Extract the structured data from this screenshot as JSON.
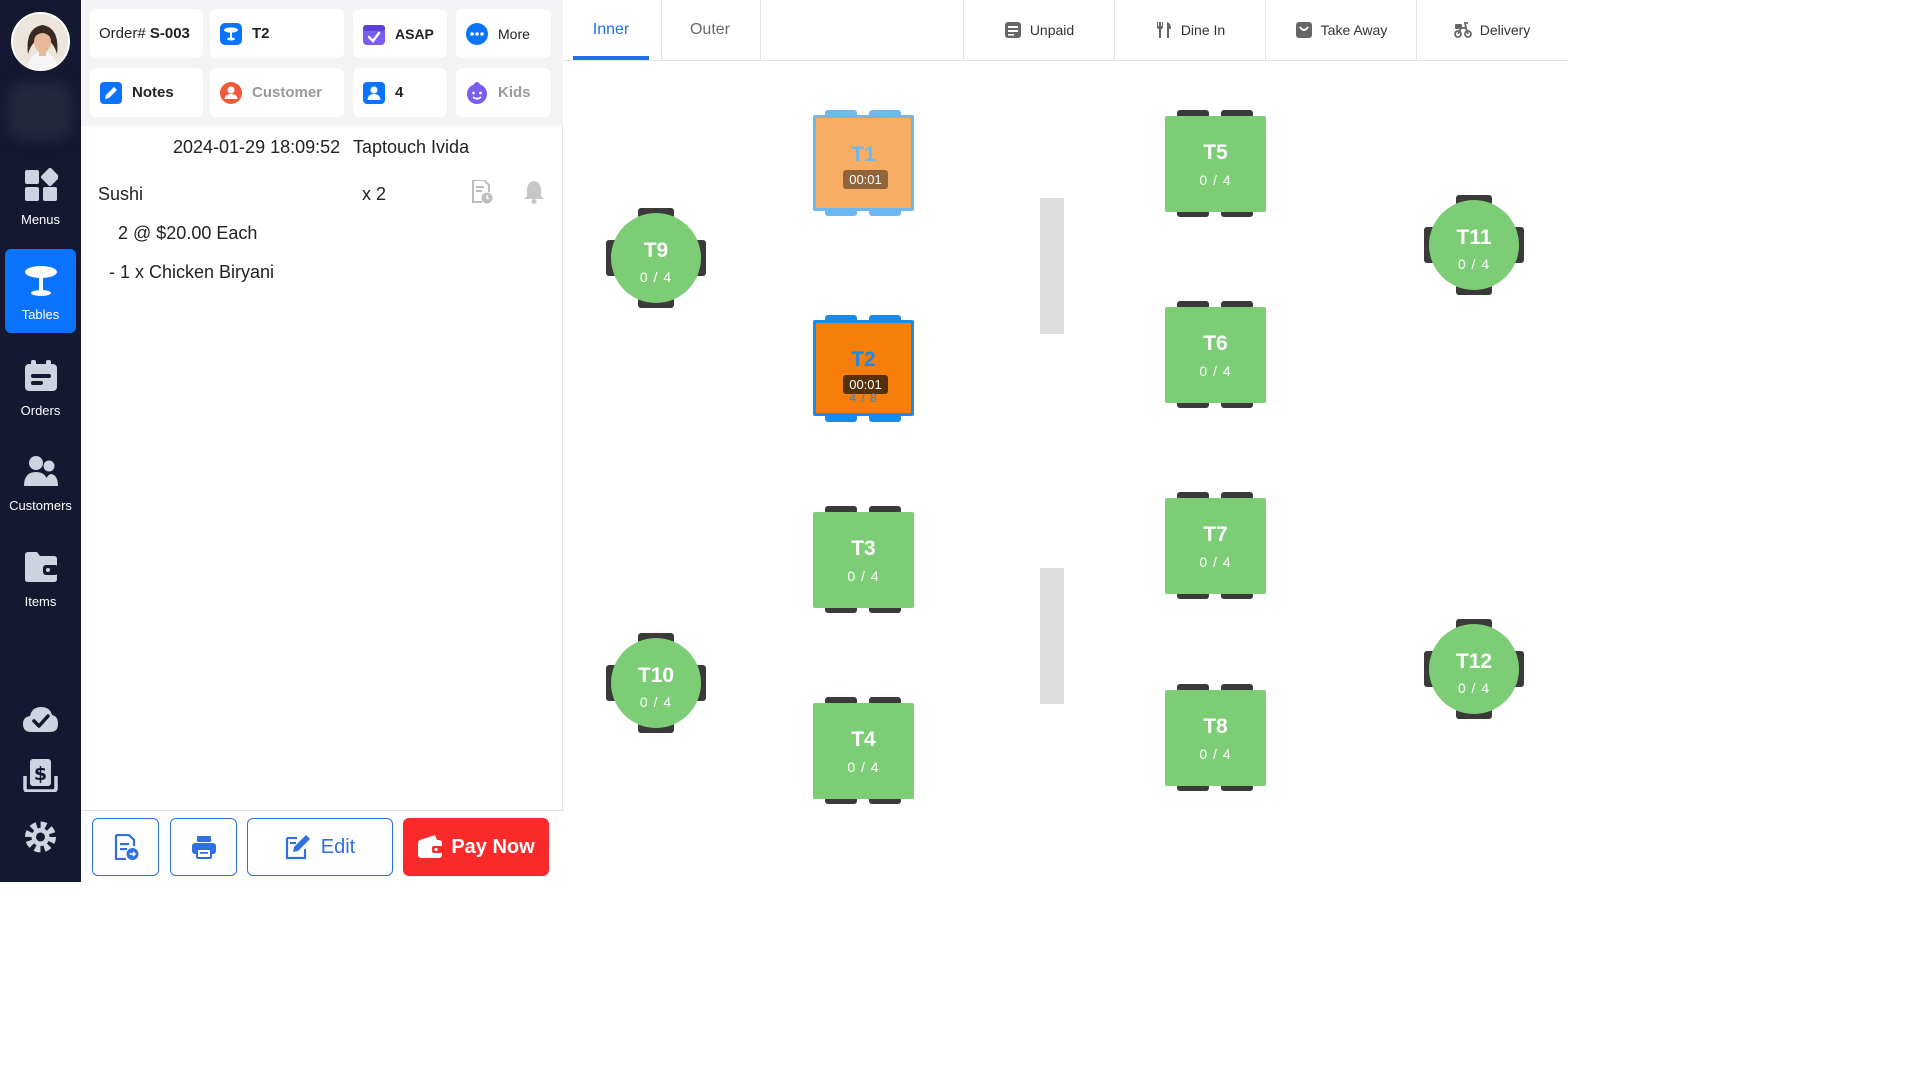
{
  "nav": {
    "items": [
      {
        "label": "Menus",
        "icon": "grid-icon"
      },
      {
        "label": "Tables",
        "icon": "table-icon"
      },
      {
        "label": "Orders",
        "icon": "orders-icon"
      },
      {
        "label": "Customers",
        "icon": "customers-icon"
      },
      {
        "label": "Items",
        "icon": "folder-icon"
      }
    ],
    "active": "Tables",
    "accent": "#0a73ff",
    "background": "#141830"
  },
  "order": {
    "number_label": "Order#",
    "number": "S-003",
    "table": "T2",
    "timing": "ASAP",
    "more": "More",
    "notes": "Notes",
    "customer": "Customer",
    "guests": "4",
    "kids": "Kids",
    "datetime": "2024-01-29 18:09:52",
    "staff": "Taptouch Ivida",
    "items": [
      {
        "name": "Sushi",
        "qty": "x 2",
        "price": "2 @ $20.00 Each",
        "modifier": "- 1 x Chicken Biryani"
      }
    ],
    "edit_label": "Edit",
    "pay_label": "Pay Now",
    "pay_color": "#fa2a2a"
  },
  "floor": {
    "tabs": [
      "Inner",
      "Outer"
    ],
    "active_tab": "Inner",
    "filters": [
      {
        "label": "Unpaid",
        "icon": "receipt-icon"
      },
      {
        "label": "Dine In",
        "icon": "utensils-icon"
      },
      {
        "label": "Take Away",
        "icon": "bag-icon"
      },
      {
        "label": "Delivery",
        "icon": "scooter-icon"
      }
    ],
    "tables": {
      "t1": {
        "name": "T1",
        "timer": "00:01",
        "status": "occupied",
        "color": "#f8ad66"
      },
      "t2": {
        "name": "T2",
        "timer": "00:01",
        "guests": "4 / 8",
        "status": "selected",
        "color": "#f77e0a"
      },
      "t3": {
        "name": "T3",
        "guests": "0 / 4"
      },
      "t4": {
        "name": "T4",
        "guests": "0 / 4"
      },
      "t5": {
        "name": "T5",
        "guests": "0 / 4"
      },
      "t6": {
        "name": "T6",
        "guests": "0 / 4"
      },
      "t7": {
        "name": "T7",
        "guests": "0 / 4"
      },
      "t8": {
        "name": "T8",
        "guests": "0 / 4"
      },
      "t9": {
        "name": "T9",
        "guests": "0 / 4"
      },
      "t10": {
        "name": "T10",
        "guests": "0 / 4"
      },
      "t11": {
        "name": "T11",
        "guests": "0 / 4"
      },
      "t12": {
        "name": "T12",
        "guests": "0 / 4"
      }
    },
    "free_color": "#7dcd76"
  }
}
